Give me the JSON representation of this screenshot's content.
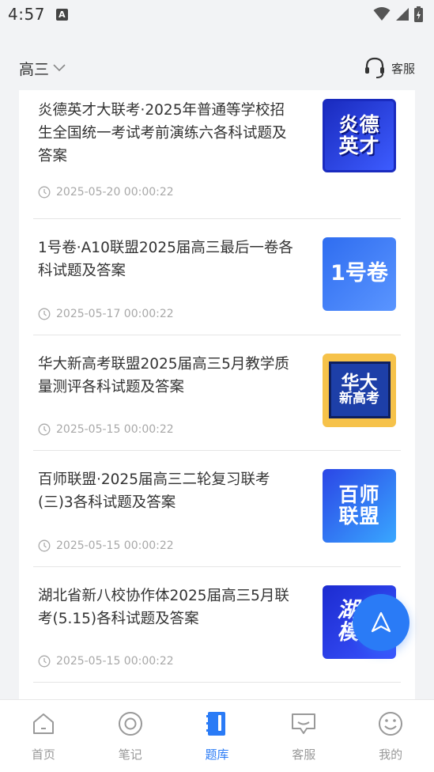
{
  "status_bar": {
    "time": "4:57",
    "notification_glyph": "A"
  },
  "header": {
    "grade": "高三",
    "service_label": "客服"
  },
  "items": [
    {
      "title": "炎德英才大联考·2025年普通等学校招生全国统一考试考前演练六各科试题及答案",
      "date": "2025-05-20 00:00:22",
      "thumb_text": [
        "炎德",
        "英才"
      ],
      "thumb_colors": [
        "#1a2bbf",
        "#3d5cff"
      ]
    },
    {
      "title": "1号卷·A10联盟2025届高三最后一卷各科试题及答案",
      "date": "2025-05-17 00:00:22",
      "thumb_text": [
        "1号卷"
      ],
      "thumb_colors": [
        "#2f6df0",
        "#5a95ff"
      ]
    },
    {
      "title": "华大新高考联盟2025届高三5月教学质量测评各科试题及答案",
      "date": "2025-05-15 00:00:22",
      "thumb_text": [
        "华大",
        "新高考"
      ],
      "thumb_colors": [
        "#f6c24a",
        "#1d3fa8"
      ]
    },
    {
      "title": "百师联盟·2025届高三二轮复习联考(三)3各科试题及答案",
      "date": "2025-05-15 00:00:22",
      "thumb_text": [
        "百师",
        "联盟"
      ],
      "thumb_colors": [
        "#2b46e6",
        "#39a7ff"
      ]
    },
    {
      "title": "湖北省新八校协作体2025届高三5月联考(5.15)各科试题及答案",
      "date": "2025-05-15 00:00:22",
      "thumb_text": [
        "湖北",
        "模拟"
      ],
      "thumb_colors": [
        "#1c2bd0",
        "#3b55ff"
      ]
    }
  ],
  "tabs": [
    {
      "label": "首页",
      "icon": "home-icon",
      "active": false
    },
    {
      "label": "笔记",
      "icon": "target-icon",
      "active": false
    },
    {
      "label": "题库",
      "icon": "book-icon",
      "active": true
    },
    {
      "label": "客服",
      "icon": "chat-icon",
      "active": false
    },
    {
      "label": "我的",
      "icon": "smile-icon",
      "active": false
    }
  ],
  "colors": {
    "accent": "#2a7bf6",
    "text": "#333333",
    "muted": "#a8a8a8",
    "background": "#f2f3f5"
  }
}
